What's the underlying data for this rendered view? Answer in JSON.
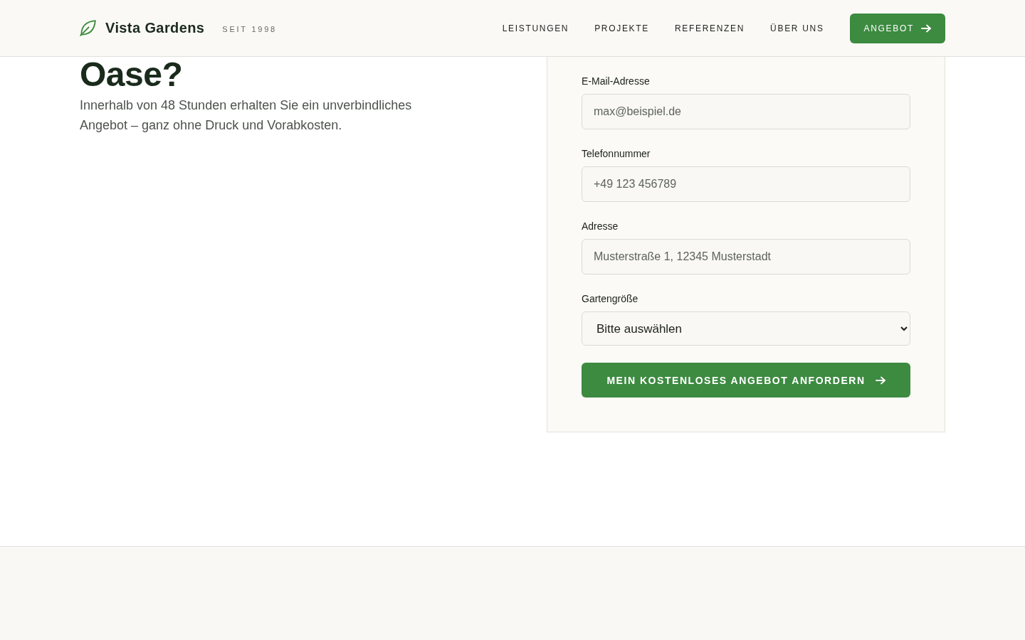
{
  "header": {
    "brand": {
      "name": "Vista Gardens",
      "tagline": "SEIT 1998"
    },
    "nav": [
      {
        "label": "LEISTUNGEN"
      },
      {
        "label": "PROJEKTE"
      },
      {
        "label": "REFERENZEN"
      },
      {
        "label": "ÜBER UNS"
      }
    ],
    "cta": {
      "label": "ANGEBOT"
    }
  },
  "hero": {
    "heading": "Oase?",
    "intro": "Innerhalb von 48 Stunden erhalten Sie ein unverbindliches Angebot – ganz ohne Druck und Vorabkosten."
  },
  "form": {
    "fields": [
      {
        "kind": "email",
        "label": "E-Mail-Adresse",
        "placeholder": "max@beispiel.de"
      },
      {
        "kind": "phone",
        "label": "Telefonnummer",
        "placeholder": "+49 123 456789"
      },
      {
        "kind": "address",
        "label": "Adresse",
        "placeholder": "Musterstraße 1, 12345 Musterstadt"
      },
      {
        "kind": "select",
        "label": "Gartengröße",
        "value": "Bitte auswählen"
      }
    ],
    "submit": {
      "label": "MEIN KOSTENLOSES ANGEBOT ANFORDERN"
    }
  }
}
